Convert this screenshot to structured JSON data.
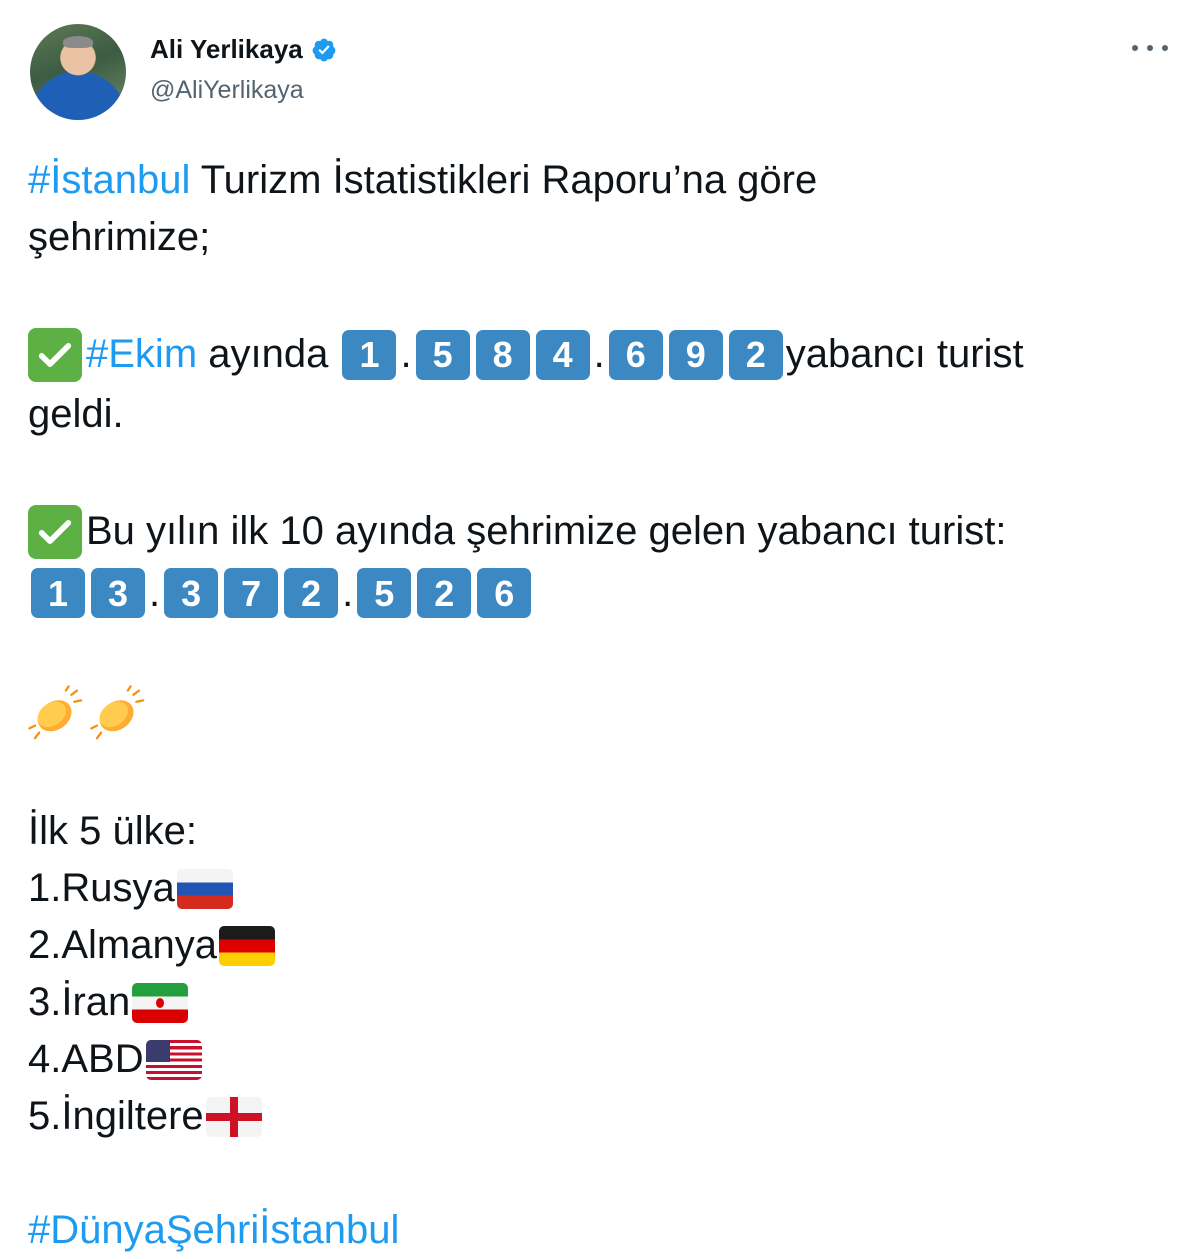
{
  "author": {
    "name": "Ali Yerlikaya",
    "handle": "@AliYerlikaya",
    "avatar_icon": "profile-photo",
    "verified_icon": "verified-badge-icon"
  },
  "tweet": {
    "line1_tag": "#İstanbul",
    "line1_text": " Turizm İstatistikleri Raporu’na göre",
    "line2_text": "şehrimize;",
    "ekim_tag": "#Ekim",
    "ekim_text": " ayında ",
    "ekim_digits_1": [
      "1"
    ],
    "ekim_digits_2": [
      "5",
      "8",
      "4"
    ],
    "ekim_digits_3": [
      "6",
      "9",
      "2"
    ],
    "ekim_sep": ".",
    "ekim_suffix": "yabancı turist",
    "geldi": "geldi.",
    "yearly_text": "Bu yılın ilk 10 ayında şehrimize gelen yabancı turist:",
    "yearly_digits_1": [
      "1",
      "3"
    ],
    "yearly_digits_2": [
      "3",
      "7",
      "2"
    ],
    "yearly_digits_3": [
      "5",
      "2",
      "6"
    ],
    "countries_title": "İlk 5 ülke:",
    "countries": [
      {
        "label": "1.Rusya",
        "flag": "russia-flag"
      },
      {
        "label": "2.Almanya",
        "flag": "germany-flag"
      },
      {
        "label": "3.İran",
        "flag": "iran-flag"
      },
      {
        "label": "4.ABD",
        "flag": "usa-flag"
      },
      {
        "label": "5.İngiltere",
        "flag": "england-flag"
      }
    ],
    "footer_tag": "#DünyaŞehriİstanbul"
  },
  "colors": {
    "link": "#1d9bf0",
    "keycap": "#3b88c3",
    "check": "#5db043",
    "secondary_text": "#536471"
  }
}
